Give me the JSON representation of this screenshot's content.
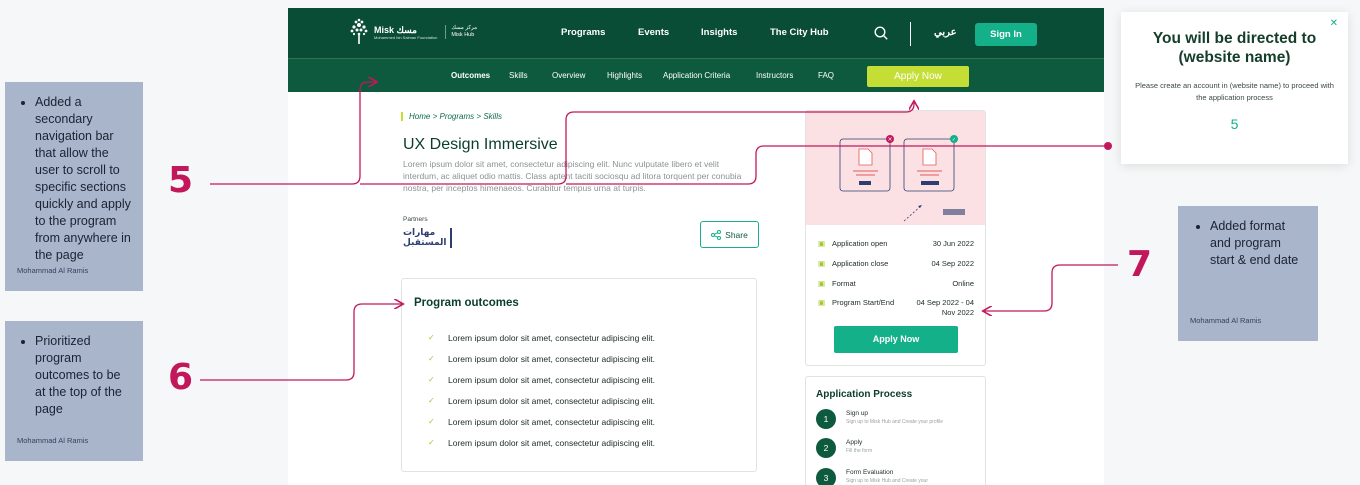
{
  "notes": [
    {
      "text": "Added a secondary navigation bar that allow the user to scroll to specific sections quickly and apply to the program from anywhere in the page",
      "author": "Mohammad Al Ramis"
    },
    {
      "text": "Prioritized program outcomes to be at the top of the page",
      "author": "Mohammad Al Ramis"
    },
    {
      "text": "Added format and program start & end date",
      "author": "Mohammad Al Ramis"
    }
  ],
  "badges": [
    "5",
    "6",
    "7"
  ],
  "popup": {
    "title": "You will be directed to (website name)",
    "body": "Please create an account in (website name) to proceed with the application process",
    "countdown": "5",
    "close_icon": "close-icon"
  },
  "header": {
    "brand": "Misk مسك",
    "brand_sub": "Mohammed bin Salman Foundation",
    "hub_ar": "مركز مسك",
    "hub_en": "Misk Hub",
    "nav": [
      "Programs",
      "Events",
      "Insights",
      "The City Hub"
    ],
    "language": "عربي",
    "signin": "Sign In"
  },
  "subnav": {
    "items": [
      "Outcomes",
      "Skills",
      "Overview",
      "Highlights",
      "Application Criteria",
      "Instructors",
      "FAQ"
    ],
    "active": "Outcomes",
    "apply": "Apply Now"
  },
  "breadcrumb": {
    "home": "Home",
    "programs": "Programs",
    "current": "Skills",
    "sep": ">"
  },
  "program": {
    "title": "UX Design Immersive",
    "description": "Lorem ipsum dolor sit amet, consectetur adipiscing elit. Nunc vulputate libero et velit interdum, ac aliquet odio mattis. Class aptent taciti sociosqu ad litora torquent per conubia nostra, per inceptos himenaeos. Curabitur tempus urna at turpis.",
    "partners_label": "Partners",
    "partner_logo_line1": "مهارات",
    "partner_logo_line2": "المستقبل",
    "share": "Share"
  },
  "outcomes": {
    "title": "Program outcomes",
    "items": [
      "Lorem ipsum dolor sit amet, consectetur adipiscing elit.",
      "Lorem ipsum dolor sit amet, consectetur adipiscing elit.",
      "Lorem ipsum dolor sit amet, consectetur adipiscing elit.",
      "Lorem ipsum dolor sit amet, consectetur adipiscing elit.",
      "Lorem ipsum dolor sit amet, consectetur adipiscing elit.",
      "Lorem ipsum dolor sit amet, consectetur adipiscing elit."
    ]
  },
  "info": {
    "rows": [
      {
        "label": "Application open",
        "value": "30  Jun 2022"
      },
      {
        "label": "Application close",
        "value": "04  Sep 2022"
      },
      {
        "label": "Format",
        "value": "Online"
      },
      {
        "label": "Program Start/End",
        "value": "04  Sep 2022 - 04 Nov 2022"
      }
    ],
    "apply": "Apply Now"
  },
  "process": {
    "title": "Application Process",
    "steps": [
      {
        "num": "1",
        "title": "Sign up",
        "desc": "Sign up to Misk Hub and Create your profile"
      },
      {
        "num": "2",
        "title": "Apply",
        "desc": "Fill the form"
      },
      {
        "num": "3",
        "title": "Form Evaluation",
        "desc": "Sign up to Misk Hub and Create your"
      }
    ]
  },
  "colors": {
    "primary": "#0a4d36",
    "accent": "#14b08a",
    "lime": "#c5de35",
    "annotation": "#c2185b",
    "note": "#a9b5cb"
  }
}
